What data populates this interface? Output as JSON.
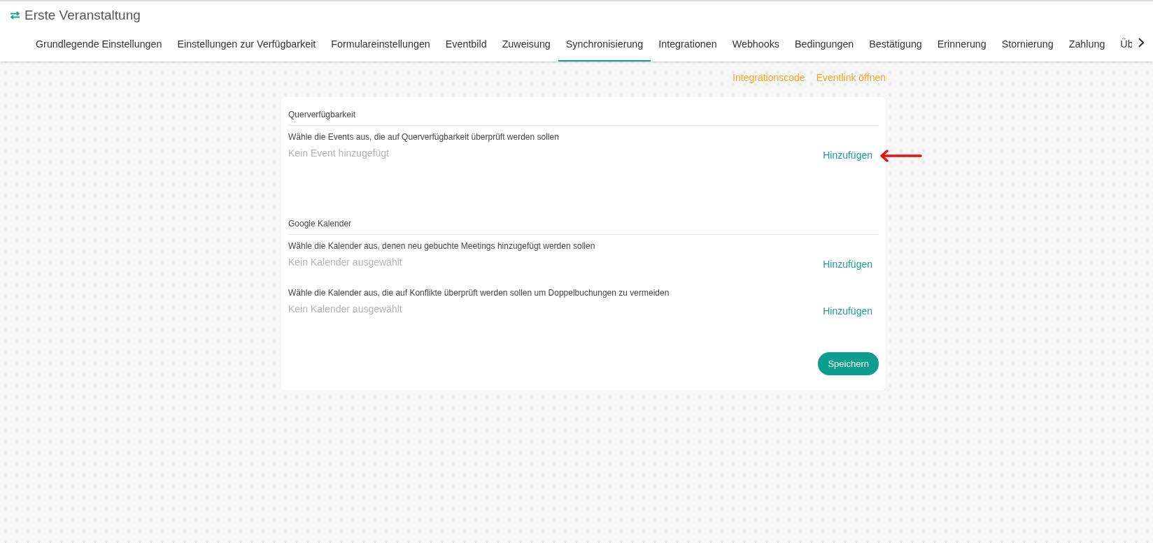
{
  "header": {
    "title": "Erste Veranstaltung"
  },
  "tabs": [
    {
      "label": "Grundlegende Einstellungen",
      "selected": false
    },
    {
      "label": "Einstellungen zur Verfügbarkeit",
      "selected": false
    },
    {
      "label": "Formulareinstellungen",
      "selected": false
    },
    {
      "label": "Eventbild",
      "selected": false
    },
    {
      "label": "Zuweisung",
      "selected": false
    },
    {
      "label": "Synchronisierung",
      "selected": true
    },
    {
      "label": "Integrationen",
      "selected": false
    },
    {
      "label": "Webhooks",
      "selected": false
    },
    {
      "label": "Bedingungen",
      "selected": false
    },
    {
      "label": "Bestätigung",
      "selected": false
    },
    {
      "label": "Erinnerung",
      "selected": false
    },
    {
      "label": "Stornierung",
      "selected": false
    },
    {
      "label": "Zahlung",
      "selected": false
    },
    {
      "label": "Üb",
      "selected": false
    }
  ],
  "links": [
    "Integrationscode",
    "Eventlink öffnen"
  ],
  "sections": [
    {
      "title": "Querverfügbarkeit",
      "rows": [
        {
          "description": "Wähle die Events aus, die auf Querverfügbarkeit überprüft werden sollen",
          "empty_text": "Kein Event hinzugefügt",
          "action": "Hinzufügen",
          "highlighted": true
        }
      ]
    },
    {
      "title": "Google Kalender",
      "rows": [
        {
          "description": "Wähle die Kalender aus, denen neu gebuchte Meetings hinzugefügt werden sollen",
          "empty_text": "Kein Kalender ausgewählt",
          "action": "Hinzufügen"
        },
        {
          "description": "Wähle die Kalender aus, die auf Konflikte überprüft werden sollen um Doppelbuchungen zu vermeiden",
          "empty_text": "Kein Kalender ausgewählt",
          "action": "Hinzufügen"
        }
      ]
    }
  ],
  "save_button": "Speichern"
}
